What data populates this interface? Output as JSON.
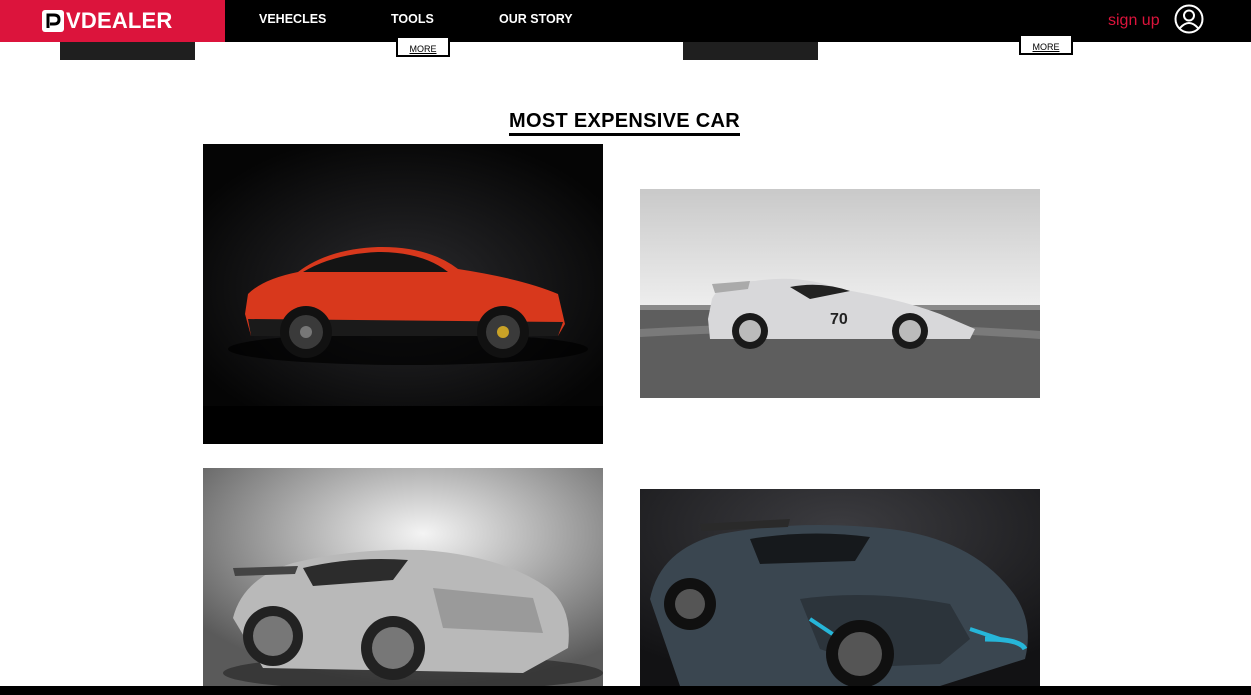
{
  "brand": {
    "logo_letter": "P",
    "logo_text": "VDEALER",
    "color": "#dc143c"
  },
  "nav": {
    "items": [
      "VEHECLES",
      "TOOLS",
      "OUR STORY"
    ]
  },
  "header": {
    "signup_label": "sign up",
    "user_icon": "user-circle-icon"
  },
  "previous_section": {
    "more_label": "MORE"
  },
  "section": {
    "title": "MOST EXPENSIVE CAR"
  },
  "cars": [
    {
      "name": "red-suv-coupe",
      "color": "#d8381c"
    },
    {
      "name": "silver-track-hypercar",
      "color": "#c8c8ca"
    },
    {
      "name": "silver-supercar",
      "color": "#bdbdbd"
    },
    {
      "name": "dark-hypercar",
      "color": "#3a4650"
    }
  ]
}
